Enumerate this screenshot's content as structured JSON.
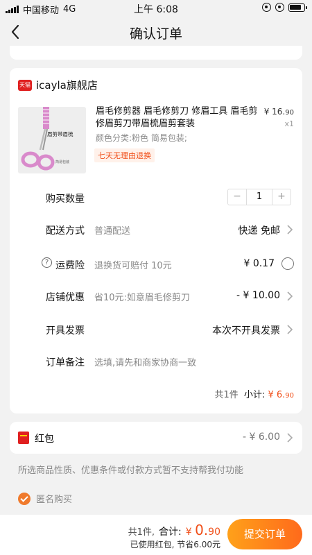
{
  "status_bar": {
    "carrier": "中国移动",
    "network": "4G",
    "time": "上午 6:08"
  },
  "nav": {
    "title": "确认订单"
  },
  "store": {
    "badge": "天猫",
    "name": "icayla旗舰店"
  },
  "product": {
    "title": "眉毛修剪器 眉毛修剪刀 修眉工具 眉毛剪 修眉剪刀带眉梳眉剪套装",
    "price_symbol": "¥",
    "price_int": "16.",
    "price_dec": "90",
    "quantity": "x1",
    "variant": "颜色分类:粉色 简易包装;",
    "return_tag": "七天无理由退换",
    "image_label": "眉剪带眉梳",
    "image_sublabel": "简易包装"
  },
  "rows": {
    "quantity": {
      "label": "购买数量",
      "minus": "−",
      "value": "1",
      "plus": "+"
    },
    "delivery": {
      "label": "配送方式",
      "sub": "普通配送",
      "value": "快递 免邮"
    },
    "insurance": {
      "icon": "?",
      "label": "运费险",
      "sub": "退换货可赔付 10元",
      "value": "¥ 0.17"
    },
    "discount": {
      "label": "店铺优惠",
      "sub": "省10元:如意眉毛修剪刀",
      "value": "- ¥ 10.00"
    },
    "invoice": {
      "label": "开具发票",
      "value": "本次不开具发票"
    },
    "note": {
      "label": "订单备注",
      "placeholder": "选填,请先和商家协商一致"
    }
  },
  "subtotal": {
    "count": "共1件",
    "label": "小计:",
    "symbol": "¥",
    "int": "6.",
    "dec": "90"
  },
  "hongbao": {
    "label": "红包",
    "value": "- ¥ 6.00"
  },
  "notice": "所选商品性质、优惠条件或付款方式暂不支持帮我付功能",
  "anonymous": {
    "label": "匿名购买",
    "checked": true
  },
  "bottom": {
    "count": "共1件,",
    "total_label": "合计:",
    "symbol": "¥",
    "total_int": "0.",
    "total_dec": "90",
    "savings": "已使用红包, 节省6.00元",
    "submit": "提交订单"
  },
  "colors": {
    "accent": "#f04e18",
    "submit_from": "#ffa11a",
    "submit_to": "#ff6a1b",
    "tmall_red": "#e02020"
  }
}
